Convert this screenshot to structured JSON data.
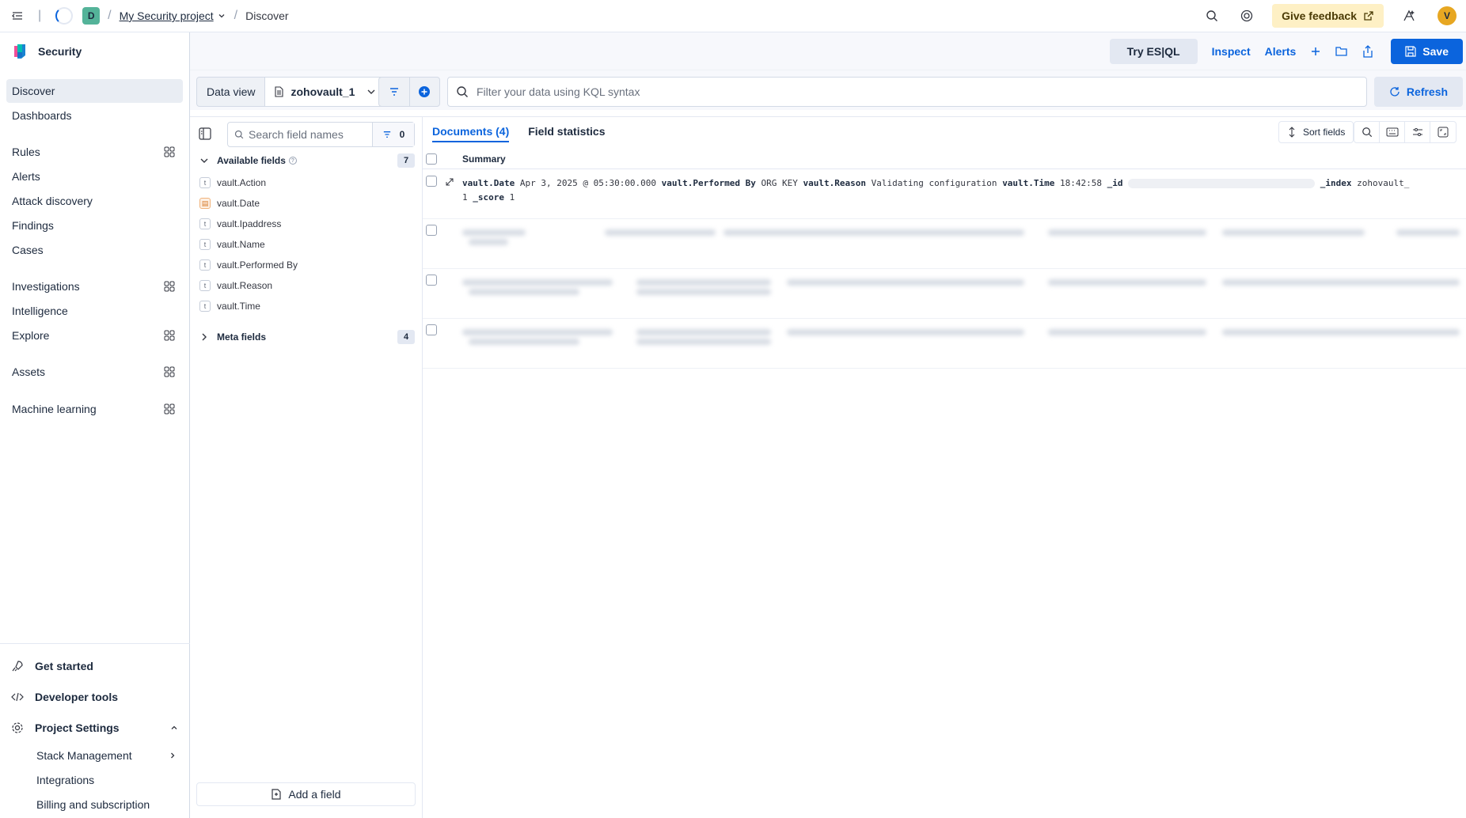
{
  "header": {
    "breadcrumb_project": "My Security project",
    "breadcrumb_current": "Discover",
    "space_badge": "D",
    "feedback_label": "Give feedback",
    "avatar_initial": "V"
  },
  "sidebar": {
    "brand": "Security",
    "items": [
      {
        "label": "Discover",
        "active": true
      },
      {
        "label": "Dashboards"
      },
      {
        "label": "Rules"
      },
      {
        "label": "Alerts"
      },
      {
        "label": "Attack discovery"
      },
      {
        "label": "Findings"
      },
      {
        "label": "Cases"
      },
      {
        "label": "Investigations"
      },
      {
        "label": "Intelligence"
      },
      {
        "label": "Explore"
      },
      {
        "label": "Assets"
      },
      {
        "label": "Machine learning"
      }
    ],
    "footer": {
      "get_started": "Get started",
      "developer_tools": "Developer tools",
      "project_settings": "Project Settings",
      "sub_items": [
        "Stack Management",
        "Integrations",
        "Billing and subscription"
      ]
    }
  },
  "toolbar": {
    "esql_label": "Try ES|QL",
    "inspect_label": "Inspect",
    "alerts_label": "Alerts",
    "save_label": "Save"
  },
  "query": {
    "data_view_label": "Data view",
    "data_view_value": "zohovault_1",
    "placeholder": "Filter your data using KQL syntax",
    "refresh_label": "Refresh"
  },
  "fields": {
    "search_placeholder": "Search field names",
    "filter_count": "0",
    "available_label": "Available fields",
    "available_count": "7",
    "available": [
      {
        "name": "vault.Action",
        "type": "t"
      },
      {
        "name": "vault.Date",
        "type": "date"
      },
      {
        "name": "vault.Ipaddress",
        "type": "t"
      },
      {
        "name": "vault.Name",
        "type": "t"
      },
      {
        "name": "vault.Performed By",
        "type": "t"
      },
      {
        "name": "vault.Reason",
        "type": "t"
      },
      {
        "name": "vault.Time",
        "type": "t"
      }
    ],
    "meta_label": "Meta fields",
    "meta_count": "4",
    "add_field_label": "Add a field"
  },
  "documents": {
    "tab_documents": "Documents (4)",
    "tab_stats": "Field statistics",
    "sort_label": "Sort fields",
    "column_summary": "Summary",
    "first_row": {
      "date_key": "vault.Date",
      "date_val": "Apr 3, 2025 @ 05:30:00.000",
      "performed_key": "vault.Performed By",
      "performed_val": "ORG KEY",
      "reason_key": "vault.Reason",
      "reason_val": "Validating configuration",
      "time_key": "vault.Time",
      "time_val": "18:42:58",
      "id_key": "_id",
      "index_key": "_index",
      "index_val": "zohovault_",
      "index_val2": "1",
      "score_key": "_score",
      "score_val": "1"
    }
  },
  "colors": {
    "accent": "#0b64dd",
    "feedback_bg": "#fef0c5",
    "badge_green": "#54b399",
    "avatar": "#e7a722"
  }
}
